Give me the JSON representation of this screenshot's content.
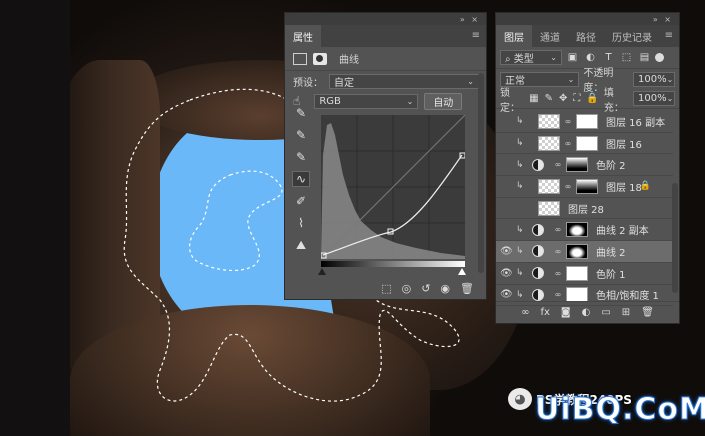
{
  "properties": {
    "tab": "属性",
    "adjustment_title": "曲线",
    "preset_label": "预设：",
    "preset_value": "自定",
    "channel_value": "RGB",
    "auto_button": "自动"
  },
  "layers_panel": {
    "tabs": [
      "图层",
      "通道",
      "路径",
      "历史记录"
    ],
    "filter_kind": "类型",
    "blend_mode": "正常",
    "opacity_label": "不透明度：",
    "opacity_value": "100%",
    "lock_label": "锁定：",
    "fill_label": "填充：",
    "fill_value": "100%",
    "layers": [
      {
        "name": "图层 16 副本",
        "visible": false,
        "clipped": true,
        "type": "pixel"
      },
      {
        "name": "图层 16",
        "visible": false,
        "clipped": true,
        "type": "pixel"
      },
      {
        "name": "色阶 2",
        "visible": false,
        "clipped": true,
        "type": "adjustment"
      },
      {
        "name": "图层 18",
        "visible": false,
        "clipped": true,
        "type": "pixel"
      },
      {
        "name": "图层 28",
        "visible": false,
        "clipped": false,
        "type": "pixel"
      },
      {
        "name": "曲线 2 副本",
        "visible": false,
        "clipped": true,
        "type": "adjustment"
      },
      {
        "name": "曲线 2",
        "visible": true,
        "clipped": true,
        "type": "adjustment",
        "selected": true
      },
      {
        "name": "色阶 1",
        "visible": true,
        "clipped": true,
        "type": "adjustment"
      },
      {
        "name": "色相/饱和度 1",
        "visible": true,
        "clipped": true,
        "type": "adjustment"
      }
    ]
  },
  "watermark": {
    "text": "PS学教程240PS",
    "big_text": "UiBQ.CoM"
  },
  "colors": {
    "sky": "#6ab8f7",
    "panel_bg": "#535353",
    "selected_layer": "#6c6c6c"
  }
}
